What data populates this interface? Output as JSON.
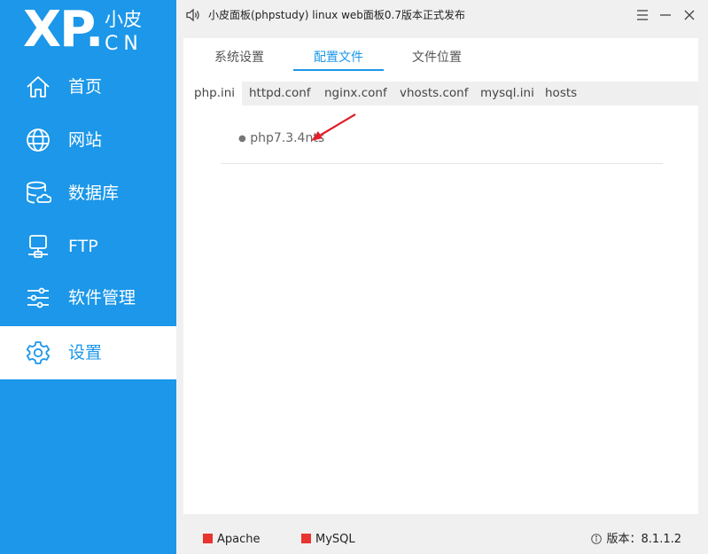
{
  "logo": {
    "mark": "XP.",
    "text_top": "小皮",
    "text_bottom": "CN"
  },
  "sidebar": {
    "items": [
      {
        "label": "首页",
        "icon": "home-icon"
      },
      {
        "label": "网站",
        "icon": "globe-icon"
      },
      {
        "label": "数据库",
        "icon": "database-icon"
      },
      {
        "label": "FTP",
        "icon": "ftp-server-icon"
      },
      {
        "label": "软件管理",
        "icon": "sliders-icon"
      },
      {
        "label": "设置",
        "icon": "gear-icon",
        "active": true
      }
    ]
  },
  "titlebar": {
    "title": "小皮面板(phpstudy) linux web面板0.7版本正式发布",
    "icon": "speaker-icon"
  },
  "tabs": [
    {
      "label": "系统设置",
      "active": false
    },
    {
      "label": "配置文件",
      "active": true
    },
    {
      "label": "文件位置",
      "active": false
    }
  ],
  "subtabs": [
    {
      "label": "php.ini",
      "active": true
    },
    {
      "label": "httpd.conf",
      "active": false
    },
    {
      "label": "nginx.conf",
      "active": false
    },
    {
      "label": "vhosts.conf",
      "active": false
    },
    {
      "label": "mysql.ini",
      "active": false
    },
    {
      "label": "hosts",
      "active": false
    }
  ],
  "file_list": [
    {
      "bullet": "●",
      "name": "php7.3.4nts"
    }
  ],
  "status": {
    "services": [
      {
        "name": "Apache",
        "status_color": "#e8342f"
      },
      {
        "name": "MySQL",
        "status_color": "#e8342f"
      }
    ],
    "version_label": "版本：8.1.1.2"
  },
  "colors": {
    "accent": "#1c97e9",
    "annotation_arrow": "#e0202a"
  }
}
